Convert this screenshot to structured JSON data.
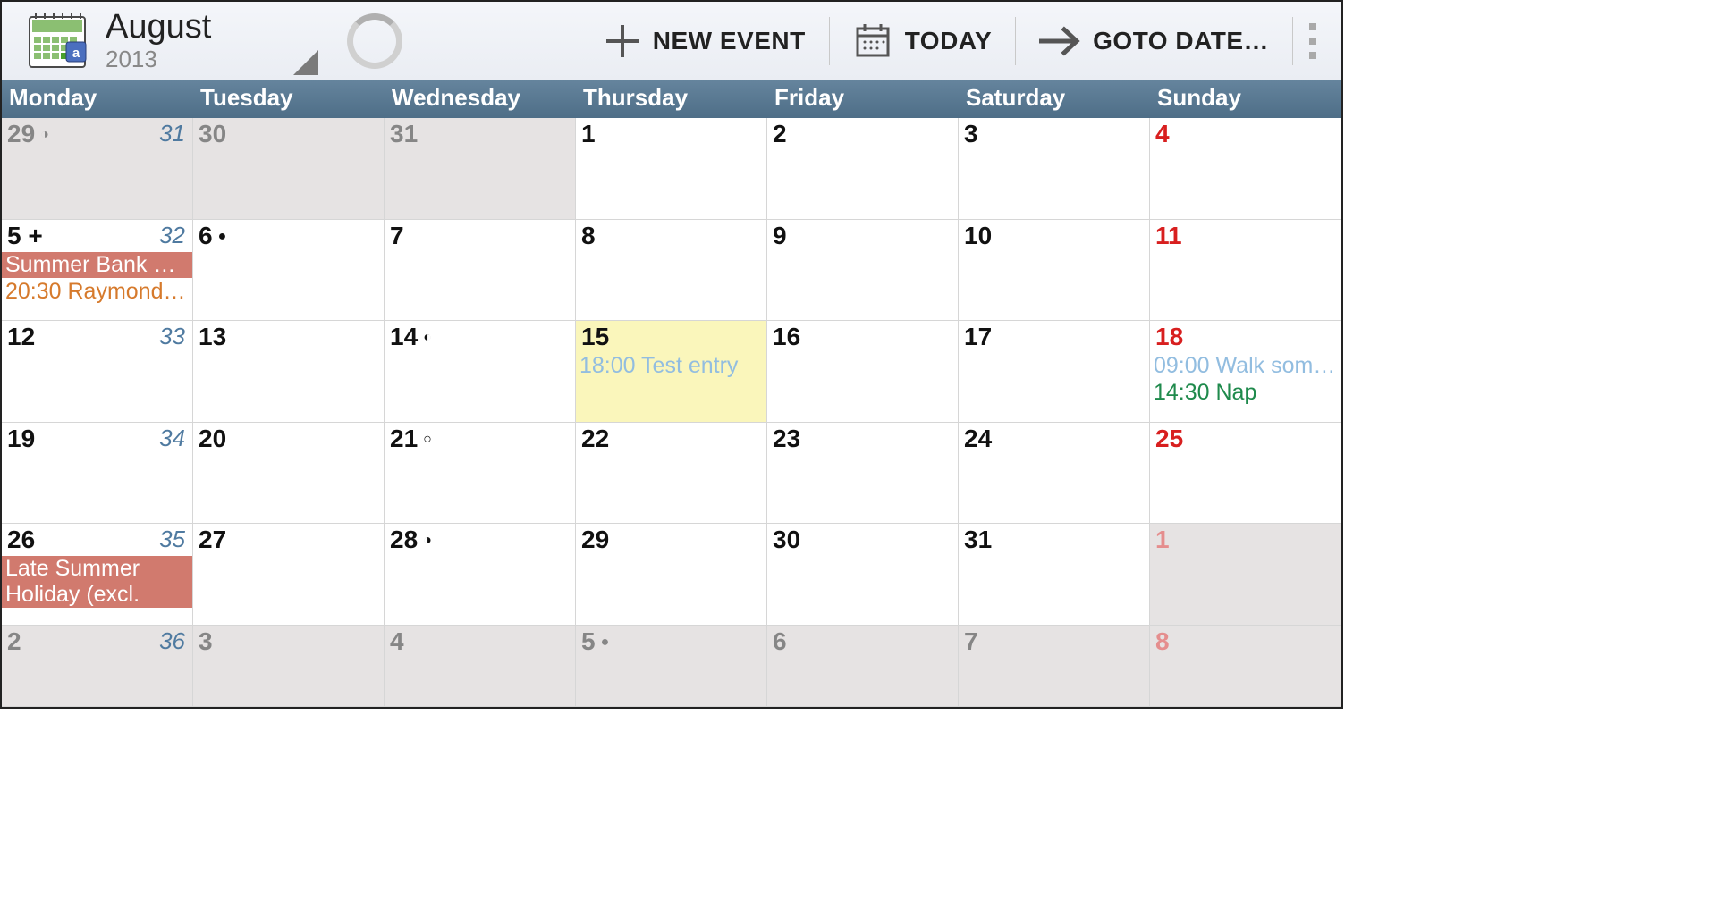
{
  "header": {
    "month": "August",
    "year": "2013",
    "actions": {
      "new_event": "NEW EVENT",
      "today": "TODAY",
      "goto_date": "GOTO DATE…"
    }
  },
  "weekdays": [
    "Monday",
    "Tuesday",
    "Wednesday",
    "Thursday",
    "Friday",
    "Saturday",
    "Sunday"
  ],
  "colors": {
    "holiday_bg": "#d17a6e",
    "timed_orange": "#d67a2c",
    "timed_lightblue": "#92bde0",
    "timed_green": "#1f8a4c"
  },
  "grid": [
    [
      {
        "num": "29",
        "other": true,
        "moon": "◑",
        "week": "31"
      },
      {
        "num": "30",
        "other": true
      },
      {
        "num": "31",
        "other": true
      },
      {
        "num": "1"
      },
      {
        "num": "2"
      },
      {
        "num": "3"
      },
      {
        "num": "4",
        "sunday": true
      }
    ],
    [
      {
        "num": "5 +",
        "week": "32",
        "events": [
          {
            "text": "Summer Bank H…",
            "allday": true,
            "bg": "holiday_bg"
          },
          {
            "text": "20:30 Raymond …",
            "color": "timed_orange"
          }
        ]
      },
      {
        "num": "6",
        "moon": "●"
      },
      {
        "num": "7"
      },
      {
        "num": "8"
      },
      {
        "num": "9"
      },
      {
        "num": "10"
      },
      {
        "num": "11",
        "sunday": true
      }
    ],
    [
      {
        "num": "12",
        "week": "33"
      },
      {
        "num": "13"
      },
      {
        "num": "14",
        "moon": "◐"
      },
      {
        "num": "15",
        "selected": true,
        "events": [
          {
            "text": "18:00 Test entry",
            "color": "timed_lightblue"
          }
        ]
      },
      {
        "num": "16"
      },
      {
        "num": "17"
      },
      {
        "num": "18",
        "sunday": true,
        "events": [
          {
            "text": "09:00 Walk some…",
            "color": "timed_lightblue"
          },
          {
            "text": "14:30 Nap",
            "color": "timed_green"
          }
        ]
      }
    ],
    [
      {
        "num": "19",
        "week": "34"
      },
      {
        "num": "20"
      },
      {
        "num": "21",
        "moon": "○"
      },
      {
        "num": "22"
      },
      {
        "num": "23"
      },
      {
        "num": "24"
      },
      {
        "num": "25",
        "sunday": true
      }
    ],
    [
      {
        "num": "26",
        "week": "35",
        "events": [
          {
            "text": "Late Summer Holiday (excl. Scotla…",
            "allday": true,
            "bg": "holiday_bg",
            "wrap": true
          }
        ]
      },
      {
        "num": "27"
      },
      {
        "num": "28",
        "moon": "◑"
      },
      {
        "num": "29"
      },
      {
        "num": "30"
      },
      {
        "num": "31"
      },
      {
        "num": "1",
        "sunday": true,
        "other": true
      }
    ],
    [
      {
        "num": "2",
        "other": true,
        "week": "36"
      },
      {
        "num": "3",
        "other": true
      },
      {
        "num": "4",
        "other": true
      },
      {
        "num": "5",
        "other": true,
        "moon": "●"
      },
      {
        "num": "6",
        "other": true
      },
      {
        "num": "7",
        "other": true
      },
      {
        "num": "8",
        "sunday": true,
        "other": true
      }
    ]
  ]
}
